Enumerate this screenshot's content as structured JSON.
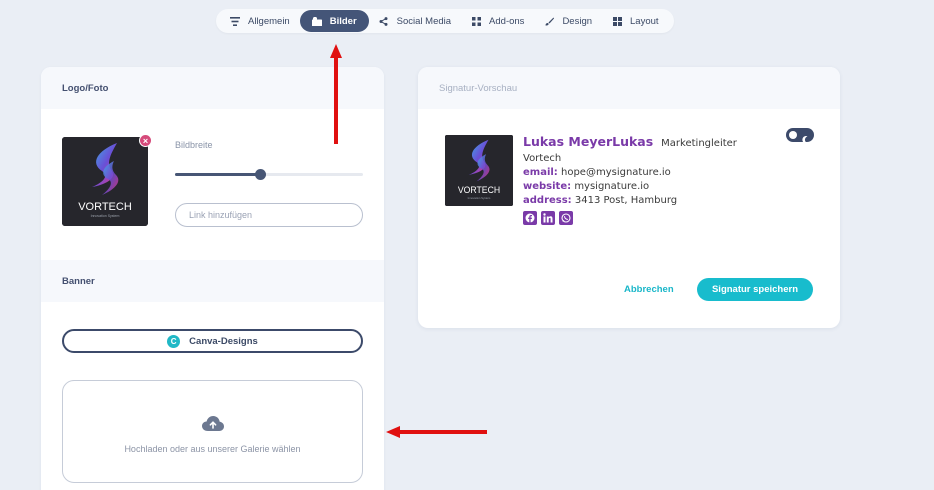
{
  "tabs": [
    {
      "label": "Allgemein",
      "icon": "lines-icon",
      "active": false
    },
    {
      "label": "Bilder",
      "icon": "image-icon",
      "active": true
    },
    {
      "label": "Social Media",
      "icon": "share-icon",
      "active": false
    },
    {
      "label": "Add-ons",
      "icon": "grid-icon",
      "active": false
    },
    {
      "label": "Design",
      "icon": "brush-icon",
      "active": false
    },
    {
      "label": "Layout",
      "icon": "layout-icon",
      "active": false
    }
  ],
  "logo_section": {
    "title": "Logo/Foto",
    "image_width_label": "Bildbreite",
    "image_width_value": 0.45,
    "link_placeholder": "Link hinzufügen",
    "logo_text_main": "VORTECH",
    "logo_text_sub": "Innovation System"
  },
  "banner_section": {
    "title": "Banner",
    "canva_button": "Canva-Designs",
    "canva_logo_letter": "C",
    "upload_text": "Hochladen oder aus unserer Galerie wählen"
  },
  "preview": {
    "title": "Signatur-Vorschau",
    "name": "Lukas MeyerLukas",
    "job_title": "Marketingleiter",
    "company": "Vortech",
    "email_label": "email:",
    "email": "hope@mysignature.io",
    "website_label": "website:",
    "website": "mysignature.io",
    "address_label": "address:",
    "address": "3413 Post, Hamburg",
    "social_icons": [
      "facebook-icon",
      "linkedin-icon",
      "whatsapp-icon"
    ],
    "cancel_label": "Abbrechen",
    "save_label": "Signatur speichern"
  },
  "colors": {
    "accent_dark": "#445578",
    "brand_purple": "#7a3aa8",
    "teal": "#18bccd",
    "annotation_red": "#e01010"
  }
}
